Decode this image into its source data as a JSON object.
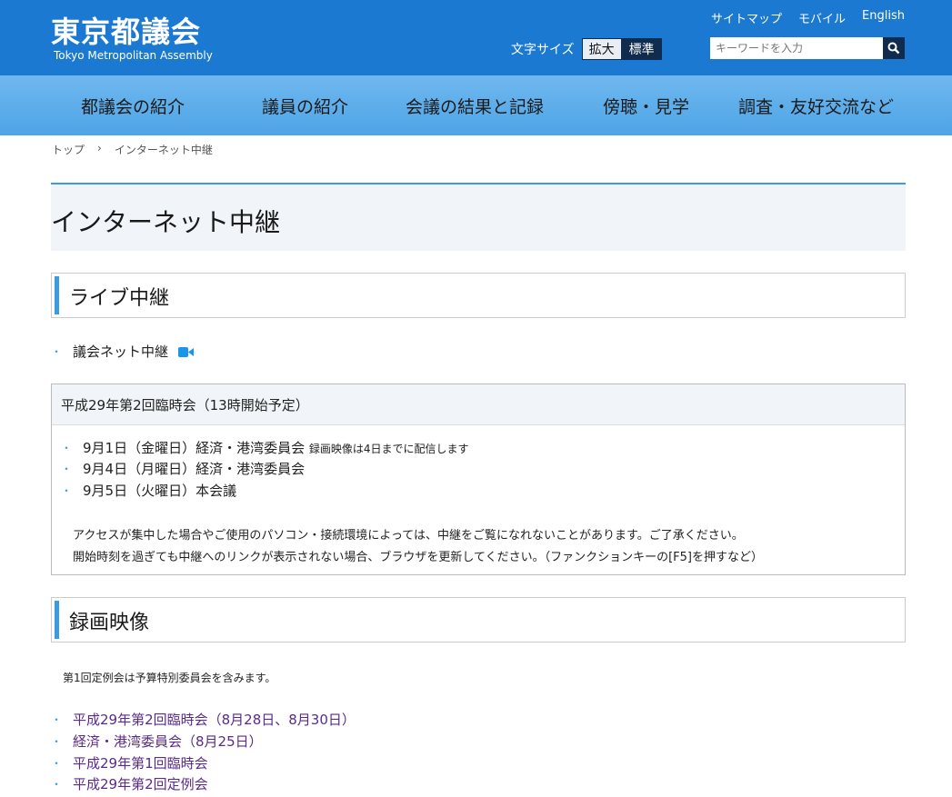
{
  "header": {
    "logo_main": "東京都議会",
    "logo_sub": "Tokyo Metropolitan Assembly",
    "util_links": [
      "サイトマップ",
      "モバイル",
      "English"
    ],
    "font_size_label": "文字サイズ",
    "font_large": "拡大",
    "font_normal": "標準",
    "search_placeholder": "キーワードを入力"
  },
  "nav": [
    "都議会の紹介",
    "議員の紹介",
    "会議の結果と記録",
    "傍聴・見学",
    "調査・友好交流など"
  ],
  "breadcrumb": [
    "トップ",
    "›",
    "インターネット中継"
  ],
  "page_title": "インターネット中継",
  "live": {
    "heading": "ライブ中継",
    "link": "議会ネット中継",
    "box_title": "平成29年第2回臨時会（13時開始予定）",
    "items": [
      {
        "text": "9月1日（金曜日）経済・港湾委員会",
        "note": "録画映像は4日までに配信します"
      },
      {
        "text": "9月4日（月曜日）経済・港湾委員会",
        "note": ""
      },
      {
        "text": "9月5日（火曜日）本会議",
        "note": ""
      }
    ],
    "notice1": "アクセスが集中した場合やご使用のパソコン・接続環境によっては、中継をご覧になれないことがあります。ご了承ください。",
    "notice2": "開始時刻を過ぎても中継へのリンクが表示されない場合、ブラウザを更新してください。（ファンクションキーの[F5]を押すなど）"
  },
  "recorded": {
    "heading": "録画映像",
    "note": "第1回定例会は予算特別委員会を含みます。",
    "links": [
      "平成29年第2回臨時会（8月28日、8月30日）",
      "経済・港湾委員会（8月25日）",
      "平成29年第1回臨時会",
      "平成29年第2回定例会"
    ]
  },
  "colors": {
    "header": "#1b79d1",
    "nav": "#5aabe9",
    "accent": "#3a9bde",
    "link": "#5a2a8c"
  }
}
